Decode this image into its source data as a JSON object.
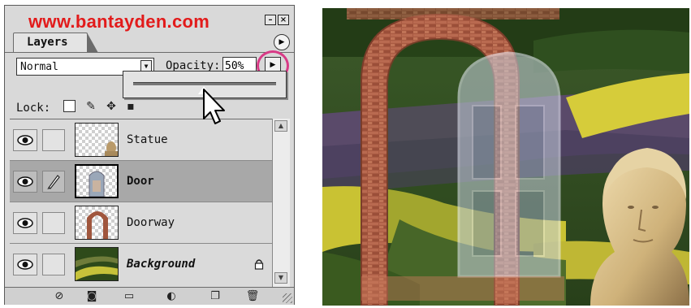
{
  "watermark": "www.bantayden.com",
  "panel": {
    "tab_label": "Layers",
    "blend_mode": "Normal",
    "opacity_label": "Opacity:",
    "opacity_value": "50%",
    "lock_label": "Lock:"
  },
  "icons": [
    "minimize-icon",
    "close-icon",
    "palette-menu-icon",
    "dropdown-arrow-icon",
    "slider-arrow-icon",
    "pointer-cursor-icon",
    "transparency-lock-icon",
    "brush-lock-icon",
    "move-lock-icon",
    "all-lock-icon",
    "eye-icon",
    "brush-icon",
    "padlock-icon",
    "layer-style-icon",
    "mask-icon",
    "folder-icon",
    "adjustment-layer-icon",
    "new-layer-icon",
    "trash-icon"
  ],
  "layers": [
    {
      "name": "Statue",
      "visible": true,
      "linked": false,
      "selected": false
    },
    {
      "name": "Door",
      "visible": true,
      "linked": true,
      "selected": true
    },
    {
      "name": "Doorway",
      "visible": true,
      "linked": false,
      "selected": false
    },
    {
      "name": "Background",
      "visible": true,
      "linked": false,
      "selected": false,
      "locked": true
    }
  ],
  "colors": {
    "watermark": "#e21b1b",
    "highlight_circle": "#d83a86",
    "selected_row": "#a8a8a8"
  }
}
